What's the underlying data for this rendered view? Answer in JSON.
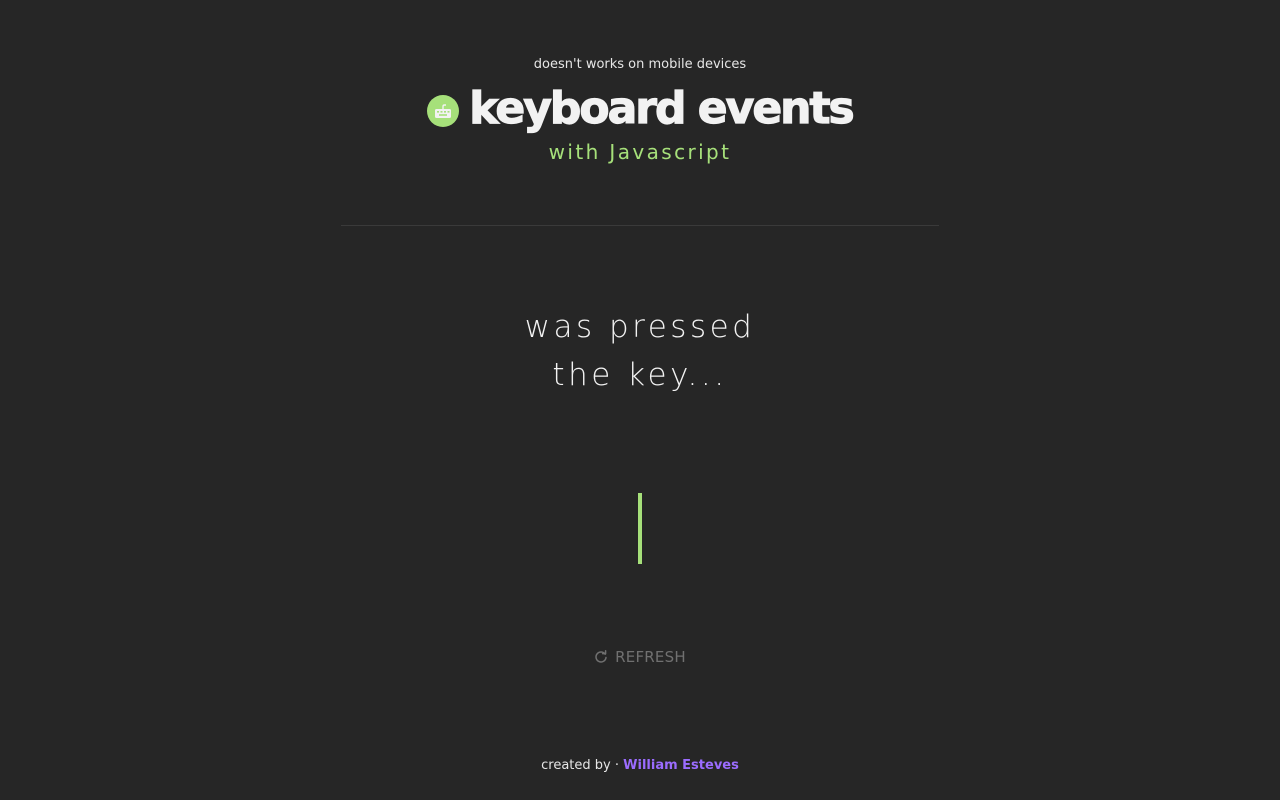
{
  "header": {
    "notice": "doesn't works on mobile devices",
    "title": "keyboard events",
    "subtitle": "with Javascript",
    "icon": "keyboard-icon"
  },
  "main": {
    "line1": "was pressed",
    "line2": "the key...",
    "refresh_label": "REFRESH",
    "refresh_icon": "refresh-icon"
  },
  "footer": {
    "created_by": "created by ·",
    "author": "William Esteves"
  },
  "colors": {
    "background": "#262626",
    "accent": "#a6e07a",
    "author": "#9b6cff",
    "muted": "#707070"
  }
}
